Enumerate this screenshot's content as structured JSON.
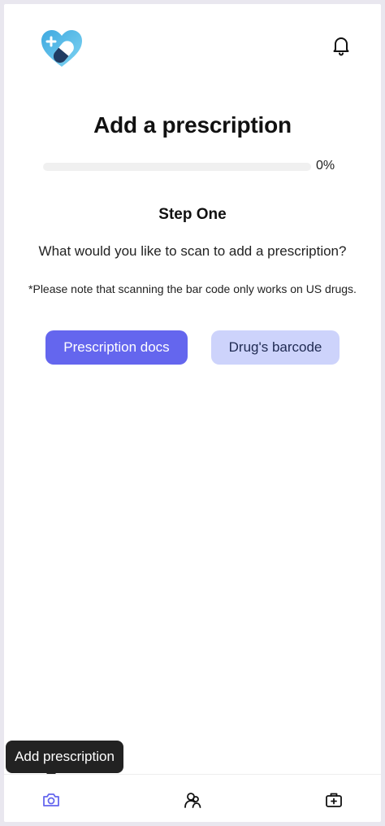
{
  "header": {
    "logo_icon": "heart-pill-logo-icon",
    "bell_icon": "bell-icon"
  },
  "main": {
    "title": "Add a prescription",
    "progress": {
      "value_percent": 0,
      "label": "0%"
    },
    "step_title": "Step One",
    "question": "What would you like to scan to add a prescription?",
    "note": "*Please note that scanning the bar code only works on US drugs.",
    "buttons": {
      "prescription_docs": "Prescription docs",
      "drugs_barcode": "Drug's barcode"
    }
  },
  "tooltip": {
    "text": "Add prescription"
  },
  "bottom_nav": {
    "items": [
      {
        "icon": "camera-icon",
        "active": true
      },
      {
        "icon": "people-icon",
        "active": false
      },
      {
        "icon": "first-aid-kit-icon",
        "active": false
      }
    ]
  },
  "colors": {
    "accent": "#6466ee",
    "secondary_button": "#cdd3fb",
    "logo_light_blue": "#5cc4ec",
    "logo_dark_blue": "#203c63"
  }
}
